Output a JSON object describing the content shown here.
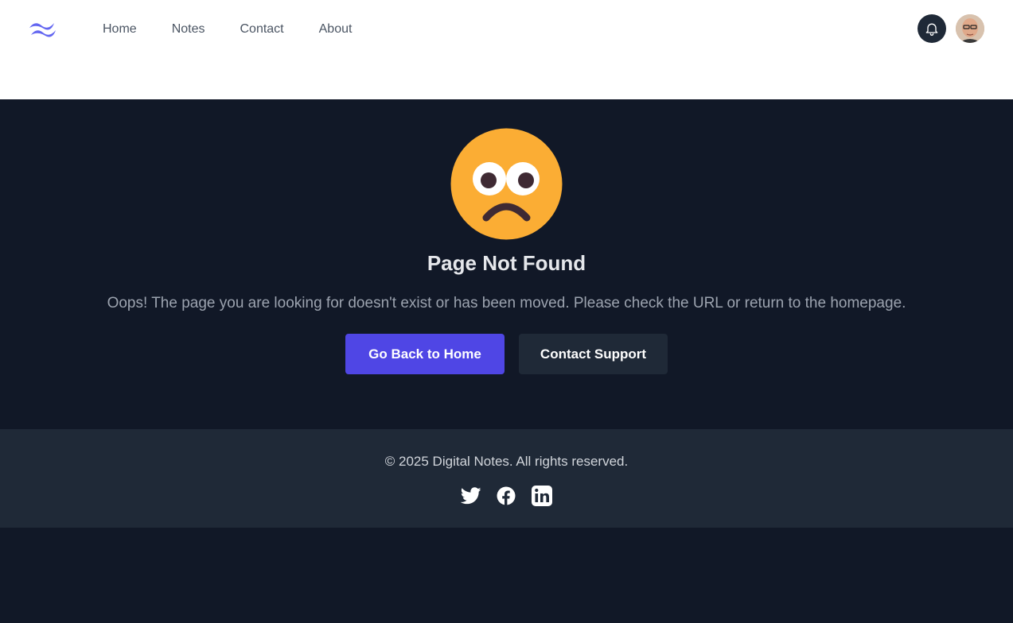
{
  "header": {
    "logo_icon": "tailwind-wave-logo",
    "nav": [
      {
        "label": "Home"
      },
      {
        "label": "Notes"
      },
      {
        "label": "Contact"
      },
      {
        "label": "About"
      }
    ],
    "notification_icon": "bell-icon",
    "avatar_icon": "user-avatar"
  },
  "main": {
    "emoji_icon": "frowning-face-icon",
    "title": "Page Not Found",
    "message": "Oops! The page you are looking for doesn't exist or has been moved. Please check the URL or return to the homepage.",
    "primary_button": "Go Back to Home",
    "secondary_button": "Contact Support"
  },
  "footer": {
    "copyright": "© 2025 Digital Notes. All rights reserved.",
    "social": [
      "twitter-icon",
      "facebook-icon",
      "linkedin-icon"
    ]
  },
  "colors": {
    "accent": "#4f46e5",
    "page_bg": "#111827",
    "footer_bg": "#1f2937",
    "emoji": "#fbad34"
  }
}
